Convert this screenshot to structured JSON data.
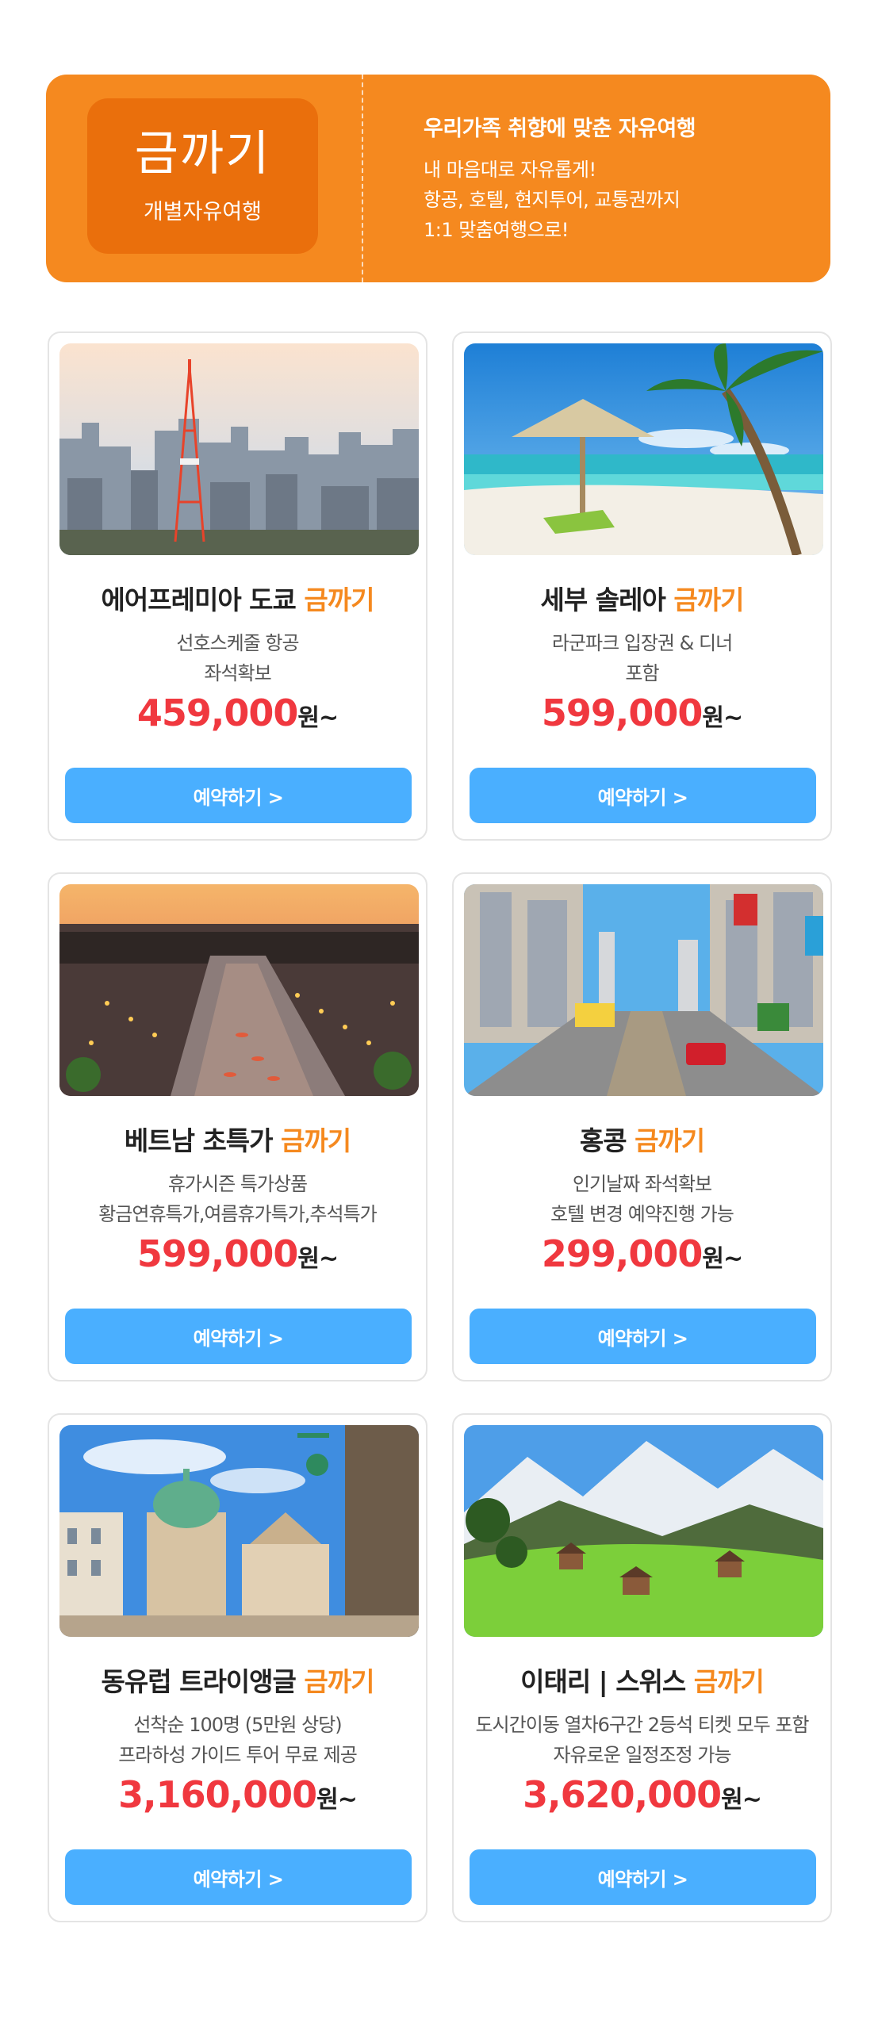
{
  "banner": {
    "logo_title": "금까기",
    "logo_subtitle": "개별자유여행",
    "headline": "우리가족 취향에 맞춘 자유여행",
    "lines": [
      "내 마음대로 자유롭게!",
      "항공, 호텔, 현지투어, 교통권까지",
      "1:1 맞춤여행으로!"
    ],
    "color": "#f5891f",
    "logo_color": "#ea6f0c"
  },
  "highlight_word": "금까기",
  "button_label": "예약하기 >",
  "price_unit": "원~",
  "colors": {
    "accent": "#f5891f",
    "price": "#f0383f",
    "button": "#4aafff"
  },
  "cards": [
    {
      "title": "에어프레미아 도쿄",
      "desc1": "선호스케줄 항공",
      "desc2": "좌석확보",
      "price": "459,000",
      "image": "tokyo-tower-cityscape"
    },
    {
      "title": "세부 솔레아",
      "desc1": "라군파크 입장권 & 디너",
      "desc2": "포함",
      "price": "599,000",
      "image": "beach-umbrella-palm"
    },
    {
      "title": "베트남 초특가",
      "desc1": "휴가시즌 특가상품",
      "desc2": "황금연휴특가,여름휴가특가,추석특가",
      "price": "599,000",
      "image": "hoian-river-lanterns"
    },
    {
      "title": "홍콩",
      "desc1": "인기날짜 좌석확보",
      "desc2": "호텔 변경 예약진행 가능",
      "price": "299,000",
      "image": "hongkong-street-tram"
    },
    {
      "title": "동유럽 트라이앵글",
      "desc1": "선착순 100명 (5만원 상당)",
      "desc2": "프라하성 가이드 투어 무료 제공",
      "price": "3,160,000",
      "image": "prague-church-square"
    },
    {
      "title": "이태리 | 스위스",
      "desc1": "도시간이동 열차6구간 2등석 티켓 모두 포함",
      "desc2": "자유로운 일정조정 가능",
      "price": "3,620,000",
      "image": "swiss-alps-village"
    }
  ]
}
